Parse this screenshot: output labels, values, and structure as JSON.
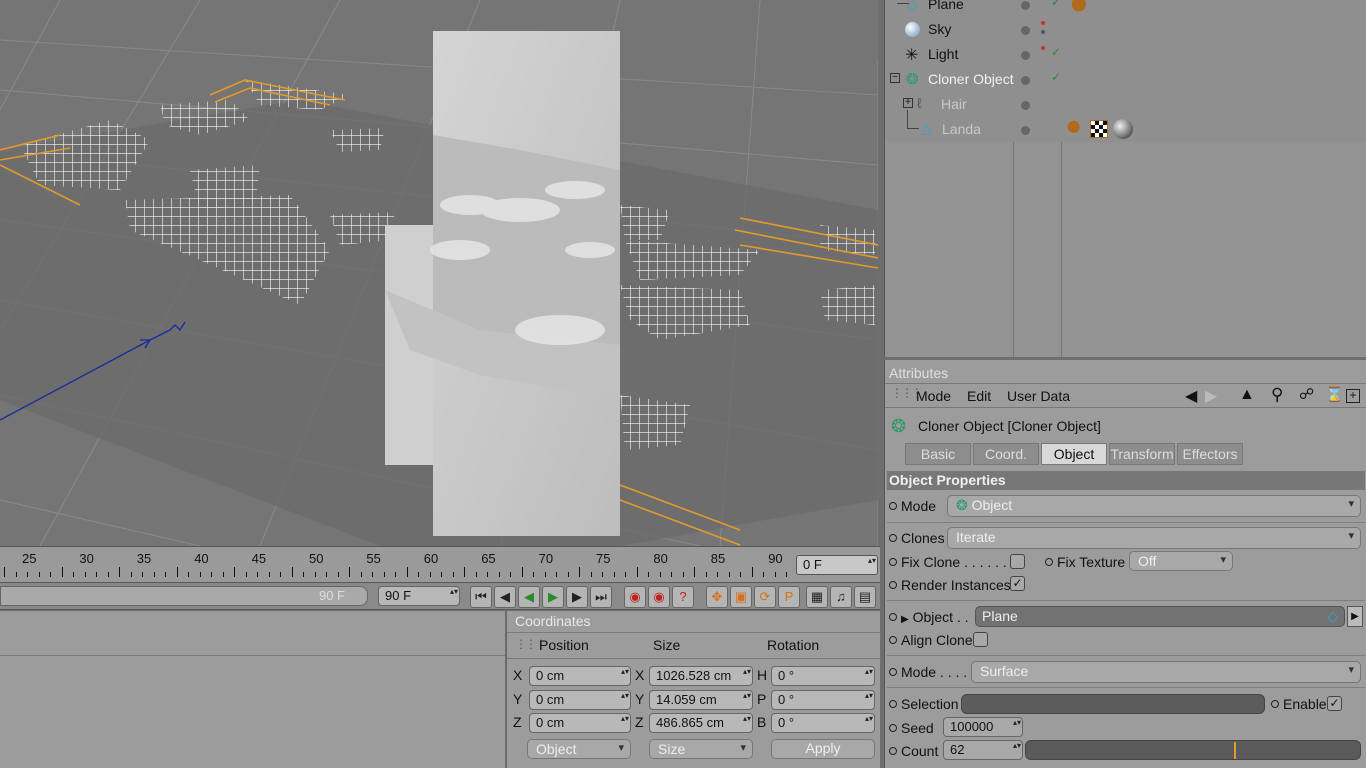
{
  "objects": {
    "items": [
      {
        "name": "Plane",
        "icon": "plane-icon"
      },
      {
        "name": "Sky",
        "icon": "sky-icon"
      },
      {
        "name": "Light",
        "icon": "light-icon"
      },
      {
        "name": "Cloner Object",
        "icon": "cloner-icon"
      },
      {
        "name": "Hair",
        "icon": "hair-icon"
      },
      {
        "name": "Landa",
        "icon": "landa-icon"
      }
    ]
  },
  "timeline": {
    "ticks": [
      "25",
      "30",
      "35",
      "40",
      "45",
      "50",
      "55",
      "60",
      "65",
      "70",
      "75",
      "80",
      "85",
      "90"
    ],
    "current_frame": "0 F",
    "end_frame": "90 F",
    "end_frame_ghost": "90 F"
  },
  "coordinates": {
    "title": "Coordinates",
    "headers": {
      "position": "Position",
      "size": "Size",
      "rotation": "Rotation"
    },
    "rows": [
      {
        "pos_label": "X",
        "pos": "0 cm",
        "size_label": "X",
        "size": "1026.528 cm",
        "rot_label": "H",
        "rot": "0 °"
      },
      {
        "pos_label": "Y",
        "pos": "0 cm",
        "size_label": "Y",
        "size": "14.059 cm",
        "rot_label": "P",
        "rot": "0 °"
      },
      {
        "pos_label": "Z",
        "pos": "0 cm",
        "size_label": "Z",
        "size": "486.865 cm",
        "rot_label": "B",
        "rot": "0 °"
      }
    ],
    "object_mode": "Object",
    "size_mode": "Size",
    "apply": "Apply"
  },
  "attributes": {
    "title": "Attributes",
    "menu": [
      "Mode",
      "Edit",
      "User Data"
    ],
    "object_title": "Cloner Object [Cloner Object]",
    "tabs": [
      "Basic",
      "Coord.",
      "Object",
      "Transform",
      "Effectors"
    ],
    "active_tab": "Object",
    "section": "Object Properties",
    "mode_label": "Mode",
    "mode_value": "Object",
    "clones_label": "Clones",
    "clones_value": "Iterate",
    "fix_clone_label": "Fix Clone . . . . . .",
    "fix_texture_label": "Fix Texture",
    "fix_texture_value": "Off",
    "render_instances_label": "Render Instances",
    "object_link_label": "Object . .",
    "object_link_value": "Plane",
    "align_clone_label": "Align Clone",
    "distribution_mode_label": "Mode . . . .",
    "distribution_mode_value": "Surface",
    "selection_label": "Selection",
    "enable_label": "Enable",
    "seed_label": "Seed",
    "seed_value": "100000",
    "count_label": "Count",
    "count_value": "62"
  }
}
